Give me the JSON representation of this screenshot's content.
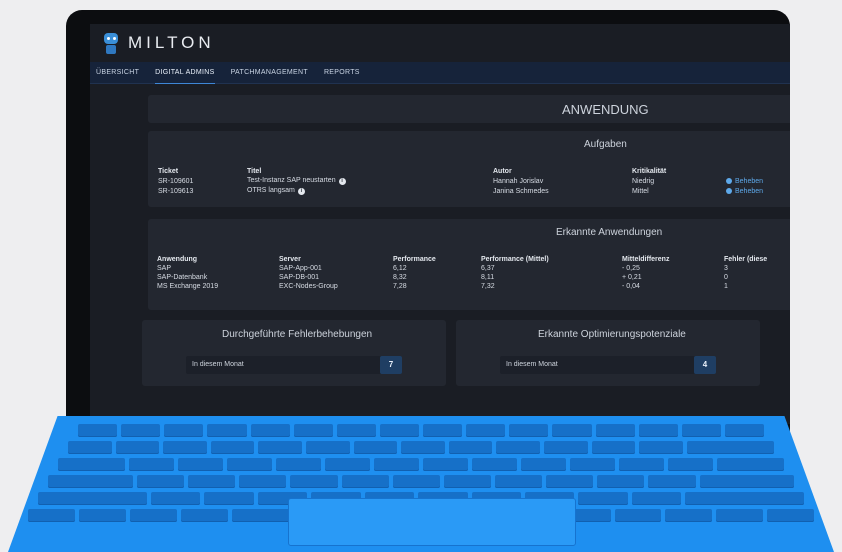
{
  "app": {
    "brand": "MILTON"
  },
  "nav": {
    "items": [
      "ÜBERSICHT",
      "DIGITAL ADMINS",
      "PATCHMANAGEMENT",
      "REPORTS"
    ],
    "active": "DIGITAL ADMINS"
  },
  "header": {
    "title": "ANWENDUNG"
  },
  "tasks": {
    "title": "Aufgaben",
    "columns": [
      "Ticket",
      "Titel",
      "Autor",
      "Kritikalität"
    ],
    "rows": [
      {
        "ticket": "SR-109601",
        "title": "Test-Instanz SAP neustarten",
        "author": "Hannah Jorislav",
        "criticality": "Niedrig",
        "action": "Beheben"
      },
      {
        "ticket": "SR-109613",
        "title": "OTRS langsam",
        "author": "Janina Schmedes",
        "criticality": "Mittel",
        "action": "Beheben"
      }
    ]
  },
  "apps": {
    "title": "Erkannte Anwendungen",
    "columns": [
      "Anwendung",
      "Server",
      "Performance",
      "Performance (Mittel)",
      "Mitteldifferenz",
      "Fehler (diese"
    ],
    "rows": [
      [
        "SAP",
        "SAP-App-001",
        "6,12",
        "6,37",
        "- 0,25",
        "3"
      ],
      [
        "SAP-Datenbank",
        "SAP-DB-001",
        "8,32",
        "8,11",
        "+ 0,21",
        "0"
      ],
      [
        "MS Exchange 2019",
        "EXC-Nodes-Group",
        "7,28",
        "7,32",
        "- 0,04",
        "1"
      ]
    ]
  },
  "fixes": {
    "title": "Durchgeführte Fehlerbehebungen",
    "label": "In diesem Monat",
    "value": "7"
  },
  "optimizations": {
    "title": "Erkannte Optimierungspotenziale",
    "label": "In diesem Monat",
    "value": "4"
  },
  "icons": {
    "info": "info-icon",
    "gear": "gear-icon",
    "logo": "robot-logo-icon"
  },
  "colors": {
    "accent": "#3e86d6",
    "keyboard": "#1e8ff0",
    "background": "#1a1d24"
  }
}
